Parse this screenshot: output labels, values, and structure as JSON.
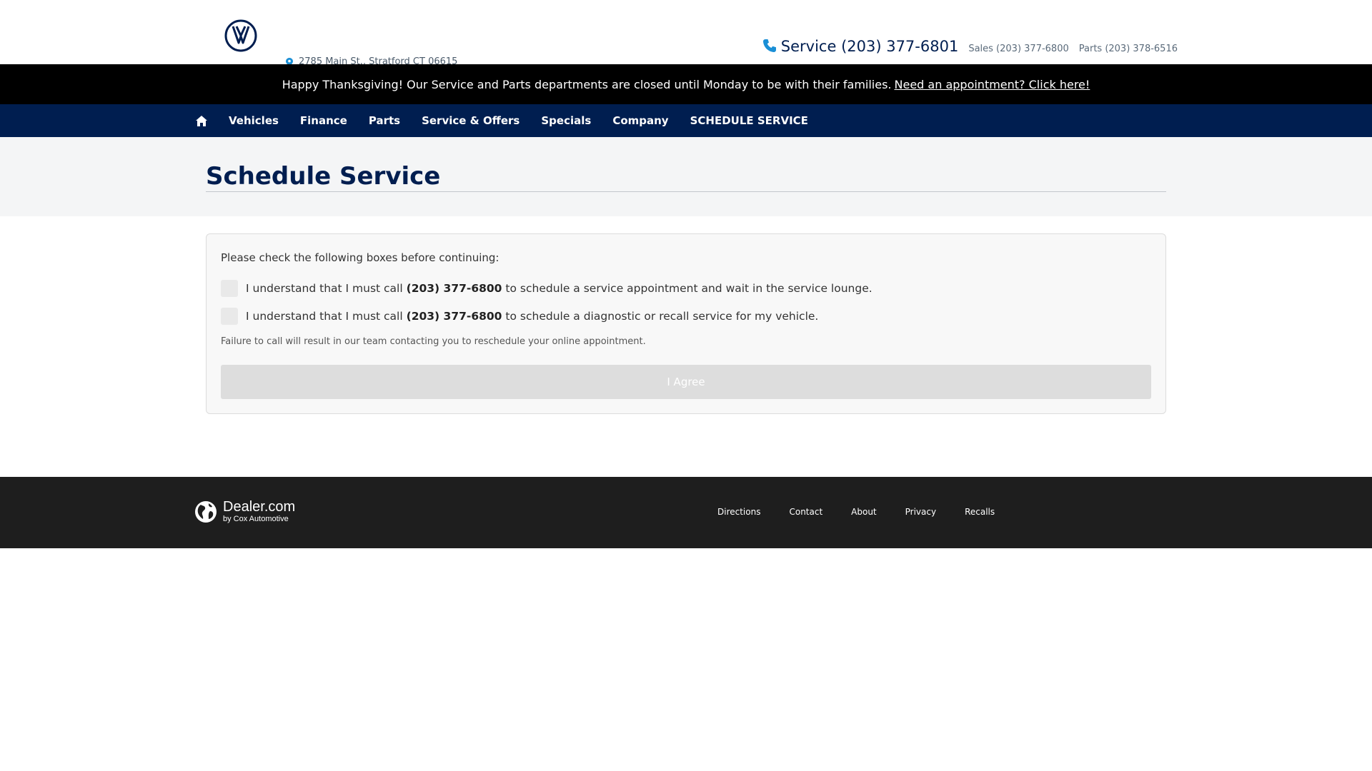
{
  "header": {
    "logo": "vw-logo",
    "address": "2785 Main St., Stratford CT 06615",
    "phones": {
      "service": "Service (203) 377-6801",
      "sales": "Sales (203) 377-6800",
      "parts": "Parts (203) 378-6516"
    }
  },
  "announcement": {
    "text": "Happy Thanksgiving! Our Service and Parts departments are closed until Monday to be with their families.",
    "link": "Need an appointment? Click here!"
  },
  "nav": {
    "home_icon": "home-icon",
    "items": [
      "Vehicles",
      "Finance",
      "Parts",
      "Service & Offers",
      "Specials",
      "Company",
      "SCHEDULE SERVICE"
    ]
  },
  "page": {
    "title": "Schedule Service"
  },
  "form": {
    "instructions": "Please check the following boxes before continuing:",
    "checks": [
      {
        "before": "I understand that I must call",
        "phone": "(203) 377-6800",
        "after": "to schedule a service appointment and wait in the service lounge.",
        "checked": false
      },
      {
        "before": "I understand that I must call",
        "phone": "(203) 377-6800",
        "after": "to schedule a diagnostic or recall service for my vehicle.",
        "checked": false
      }
    ],
    "note": "Failure to call will result in our team contacting you to reschedule your online appointment.",
    "button": "I Agree"
  },
  "footer": {
    "brand": "Dealer.com",
    "brand_sub": "by Cox Automotive",
    "links": [
      "Directions",
      "Contact",
      "About",
      "Privacy",
      "Recalls"
    ]
  },
  "colors": {
    "brand_navy": "#001e50",
    "phone_icon": "#1a8fd6",
    "announce_bg": "#000000",
    "footer_bg": "#1e1e1e"
  }
}
